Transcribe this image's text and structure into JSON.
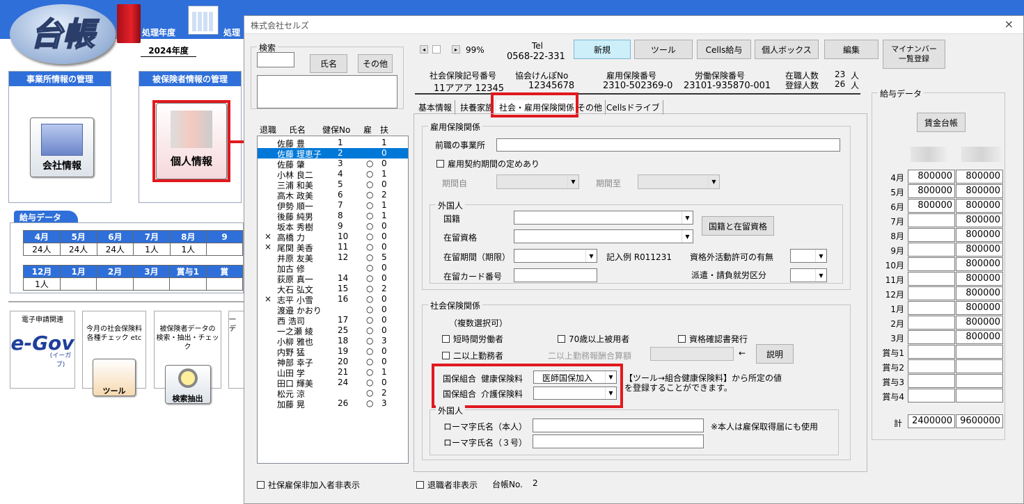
{
  "main_app": {
    "logo_text": "台帳",
    "year_label": "処理年度",
    "year_value": "2024年度",
    "label2": "処理",
    "office_section": "事業所情報の管理",
    "company_btn": "会社情報",
    "insured_section": "被保険者情報の管理",
    "personal_btn": "個人情報",
    "salary_title": "給与データ",
    "months1": [
      "4月",
      "5月",
      "6月",
      "7月",
      "8月",
      "9"
    ],
    "counts1": [
      "24人",
      "24人",
      "24人",
      "1人",
      "1人",
      ""
    ],
    "months2": [
      "12月",
      "1月",
      "2月",
      "3月",
      "賞与1",
      "賞"
    ],
    "counts2": [
      "1人",
      "",
      "",
      "",
      "",
      ""
    ],
    "egov_label": "電子申請関連",
    "egov_logo": "e-Gov",
    "egov_small": "(イーガブ)",
    "tool_label": "今月の社会保険料\n各種チェック etc",
    "tool_btn": "ツール",
    "search_label": "被保険者データの\n検索・抽出・チェック",
    "search_btn": "検索抽出",
    "extra_label": "一\nデ"
  },
  "dialog": {
    "title": "株式会社セルズ",
    "close": "×",
    "search_group": "検索",
    "search_value": "",
    "name_btn": "氏名",
    "other_btn": "その他",
    "zoom": "99%",
    "tel_label": "Tel",
    "tel_value": "0568-22-331",
    "toolbar": [
      "新規",
      "ツール",
      "Cells給与",
      "個人ボックス",
      "編集",
      "マイナンバー\n一覧登録"
    ],
    "info_headers": [
      "社会保険記号番号",
      "協会けんぽNo",
      "雇用保険番号",
      "労働保険番号"
    ],
    "info_values": [
      "11アアア 12345",
      "12345678",
      "2310-502369-0",
      "23101-935870-001"
    ],
    "emp_label": "在職人数",
    "emp_count": "23",
    "emp_unit": "人",
    "reg_label": "登録人数",
    "reg_count": "26",
    "reg_unit": "人",
    "tabs": [
      "基本情報",
      "扶養家族",
      "社会・雇用保険関係",
      "その他",
      "Cellsドライブ"
    ],
    "list_headers": [
      "退職",
      "氏名",
      "健保No",
      "雇",
      "扶"
    ],
    "employees": [
      {
        "ret": "",
        "name": "佐藤 豊",
        "no": "1",
        "koyo": "",
        "fu": "1"
      },
      {
        "ret": "",
        "name": "佐藤 理恵子",
        "no": "2",
        "koyo": "",
        "fu": "0"
      },
      {
        "ret": "",
        "name": "佐藤 肇",
        "no": "3",
        "koyo": "○",
        "fu": "0"
      },
      {
        "ret": "",
        "name": "小林 良二",
        "no": "4",
        "koyo": "○",
        "fu": "1"
      },
      {
        "ret": "",
        "name": "三浦 和美",
        "no": "5",
        "koyo": "○",
        "fu": "0"
      },
      {
        "ret": "",
        "name": "高木 政美",
        "no": "6",
        "koyo": "○",
        "fu": "2"
      },
      {
        "ret": "",
        "name": "伊勢 順一",
        "no": "7",
        "koyo": "○",
        "fu": "1"
      },
      {
        "ret": "",
        "name": "後藤 純男",
        "no": "8",
        "koyo": "○",
        "fu": "1"
      },
      {
        "ret": "",
        "name": "坂本 秀樹",
        "no": "9",
        "koyo": "○",
        "fu": "0"
      },
      {
        "ret": "×",
        "name": "高橋 力",
        "no": "10",
        "koyo": "○",
        "fu": "0"
      },
      {
        "ret": "×",
        "name": "尾関 美香",
        "no": "11",
        "koyo": "○",
        "fu": "0"
      },
      {
        "ret": "",
        "name": "井原 友美",
        "no": "12",
        "koyo": "○",
        "fu": "5"
      },
      {
        "ret": "",
        "name": "加古 修",
        "no": "",
        "koyo": "○",
        "fu": "0"
      },
      {
        "ret": "",
        "name": "荻原 真一",
        "no": "14",
        "koyo": "○",
        "fu": "0"
      },
      {
        "ret": "",
        "name": "大石 弘文",
        "no": "15",
        "koyo": "○",
        "fu": "2"
      },
      {
        "ret": "×",
        "name": "志平 小雪",
        "no": "16",
        "koyo": "○",
        "fu": "0"
      },
      {
        "ret": "",
        "name": "渡邉 かおり",
        "no": "",
        "koyo": "○",
        "fu": "0"
      },
      {
        "ret": "",
        "name": "西 浩司",
        "no": "17",
        "koyo": "○",
        "fu": "0"
      },
      {
        "ret": "",
        "name": "一之瀬 綾",
        "no": "25",
        "koyo": "○",
        "fu": "0"
      },
      {
        "ret": "",
        "name": "小柳 雅也",
        "no": "18",
        "koyo": "○",
        "fu": "3"
      },
      {
        "ret": "",
        "name": "内野 猛",
        "no": "19",
        "koyo": "○",
        "fu": "0"
      },
      {
        "ret": "",
        "name": "神部 幸子",
        "no": "20",
        "koyo": "○",
        "fu": "0"
      },
      {
        "ret": "",
        "name": "山田 学",
        "no": "21",
        "koyo": "○",
        "fu": "1"
      },
      {
        "ret": "",
        "name": "田口 輝美",
        "no": "24",
        "koyo": "○",
        "fu": "0"
      },
      {
        "ret": "",
        "name": "松元 涼",
        "no": "",
        "koyo": "○",
        "fu": "2"
      },
      {
        "ret": "",
        "name": "加藤 晃",
        "no": "26",
        "koyo": "○",
        "fu": "3"
      }
    ],
    "koyo": {
      "group": "雇用保険関係",
      "prev_office": "前職の事業所",
      "contract_chk": "雇用契約期間の定めあり",
      "from": "期間自",
      "to": "期間至",
      "foreign_group": "外国人",
      "nationality": "国籍",
      "status": "在留資格",
      "nat_btn": "国籍と在留資格",
      "period": "在留期間（期限）",
      "example": "記入例 R011231",
      "outside": "資格外活動許可の有無",
      "card": "在留カード番号",
      "dispatch": "派遣・請負就労区分"
    },
    "shaho": {
      "group": "社会保険関係",
      "multi": "（複数選択可）",
      "chk1": "短時間労働者",
      "chk2": "70歳以上被用者",
      "chk3": "資格確認書発行",
      "chk4": "二以上勤務者",
      "multi_pay": "二以上勤務報酬合算額",
      "arrow": "←",
      "explain_btn": "説明",
      "kk_label": "国保組合",
      "kk_health": "健康保険料",
      "kk_health_value": "医師国保加入",
      "kk_label2": "国保組合",
      "kk_care": "介護保険料",
      "kk_care_value": "",
      "note1": "【ツール→組合健康保険料】から所定の値",
      "note2": "を登録することができます。",
      "foreign_group": "外国人",
      "roma1": "ローマ字氏名（本人）",
      "roma2": "ローマ字氏名（３号）",
      "roma_note": "※本人は雇保取得届にも使用"
    },
    "salary": {
      "group": "給与データ",
      "ledger_btn": "賃金台帳",
      "months": [
        "4月",
        "5月",
        "6月",
        "7月",
        "8月",
        "9月",
        "10月",
        "11月",
        "12月",
        "1月",
        "2月",
        "3月",
        "賞与1",
        "賞与2",
        "賞与3",
        "賞与4"
      ],
      "col1": [
        "800000",
        "800000",
        "800000",
        "",
        "",
        "",
        "",
        "",
        "",
        "",
        "",
        "",
        "",
        "",
        "",
        ""
      ],
      "col2": [
        "800000",
        "800000",
        "800000",
        "800000",
        "800000",
        "800000",
        "800000",
        "800000",
        "800000",
        "800000",
        "800000",
        "800000",
        "",
        "",
        "",
        ""
      ],
      "total_label": "計",
      "total1": "2400000",
      "total2": "9600000"
    },
    "bottom": {
      "hide_unins": "社保雇保非加入者非表示",
      "hide_ret": "退職者非表示",
      "daicho_label": "台帳No.",
      "daicho_value": "2"
    }
  },
  "colors": {
    "accent": "#2f6fd9",
    "highlight": "#e0191f",
    "selection": "#0078d7"
  }
}
